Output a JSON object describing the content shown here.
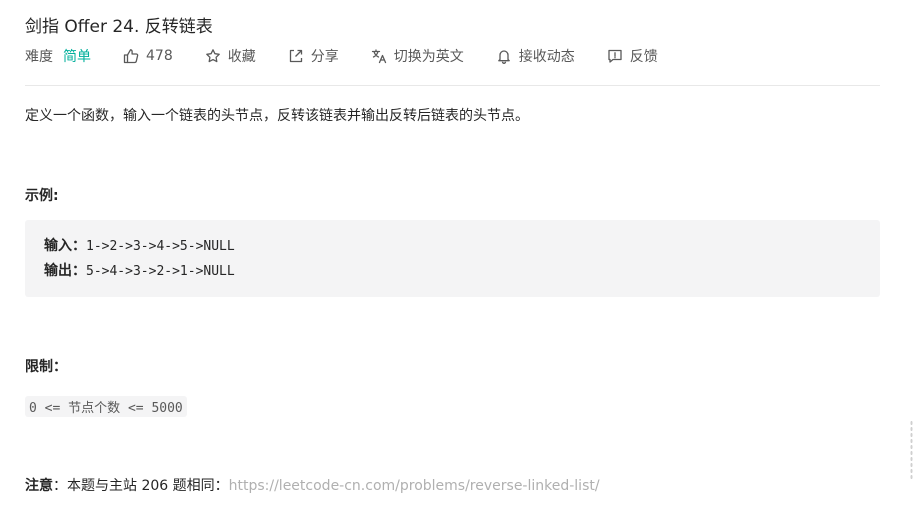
{
  "problem": {
    "title": "剑指 Offer 24. 反转链表",
    "difficulty_label": "难度",
    "difficulty": "简单",
    "likes": "478",
    "actions": {
      "collect": "收藏",
      "share": "分享",
      "switch_lang": "切换为英文",
      "notify": "接收动态",
      "feedback": "反馈"
    }
  },
  "content": {
    "description": "定义一个函数，输入一个链表的头节点，反转该链表并输出反转后链表的头节点。",
    "example_heading": "示例:",
    "example": {
      "input_label": "输入：",
      "input_value": "1->2->3->4->5->NULL",
      "output_label": "输出：",
      "output_value": "5->4->3->2->1->NULL"
    },
    "limit_heading": "限制：",
    "limit_code": "0 <= 节点个数 <= 5000",
    "note_label": "注意",
    "note_text": "：本题与主站 206 题相同：",
    "note_link": "https://leetcode-cn.com/problems/reverse-linked-list/"
  },
  "colors": {
    "difficulty_easy": "#00af9b",
    "link": "#b0b0b0",
    "code_bg": "#f4f4f5"
  }
}
